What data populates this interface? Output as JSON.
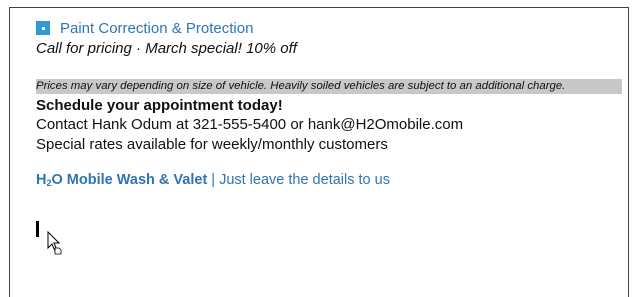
{
  "heading": "Paint Correction & Protection",
  "pricing_line": "Call for pricing · March special! 10% off",
  "note": "Prices may vary depending on size of vehicle. Heavily soiled vehicles are subject to an additional charge.",
  "schedule": "Schedule your appointment today!",
  "contact": "Contact Hank Odum at 321-555-5400 or hank@H2Omobile.com",
  "special_rates": "Special rates available for weekly/monthly customers",
  "brand": {
    "h": "H",
    "sub": "2",
    "rest": "O Mobile Wash & Valet",
    "separator": "|",
    "tagline": "Just leave the details to us"
  },
  "colors": {
    "accent": "#2f75b5",
    "bullet": "#2e9bd6",
    "highlight": "#c8c8c8"
  }
}
